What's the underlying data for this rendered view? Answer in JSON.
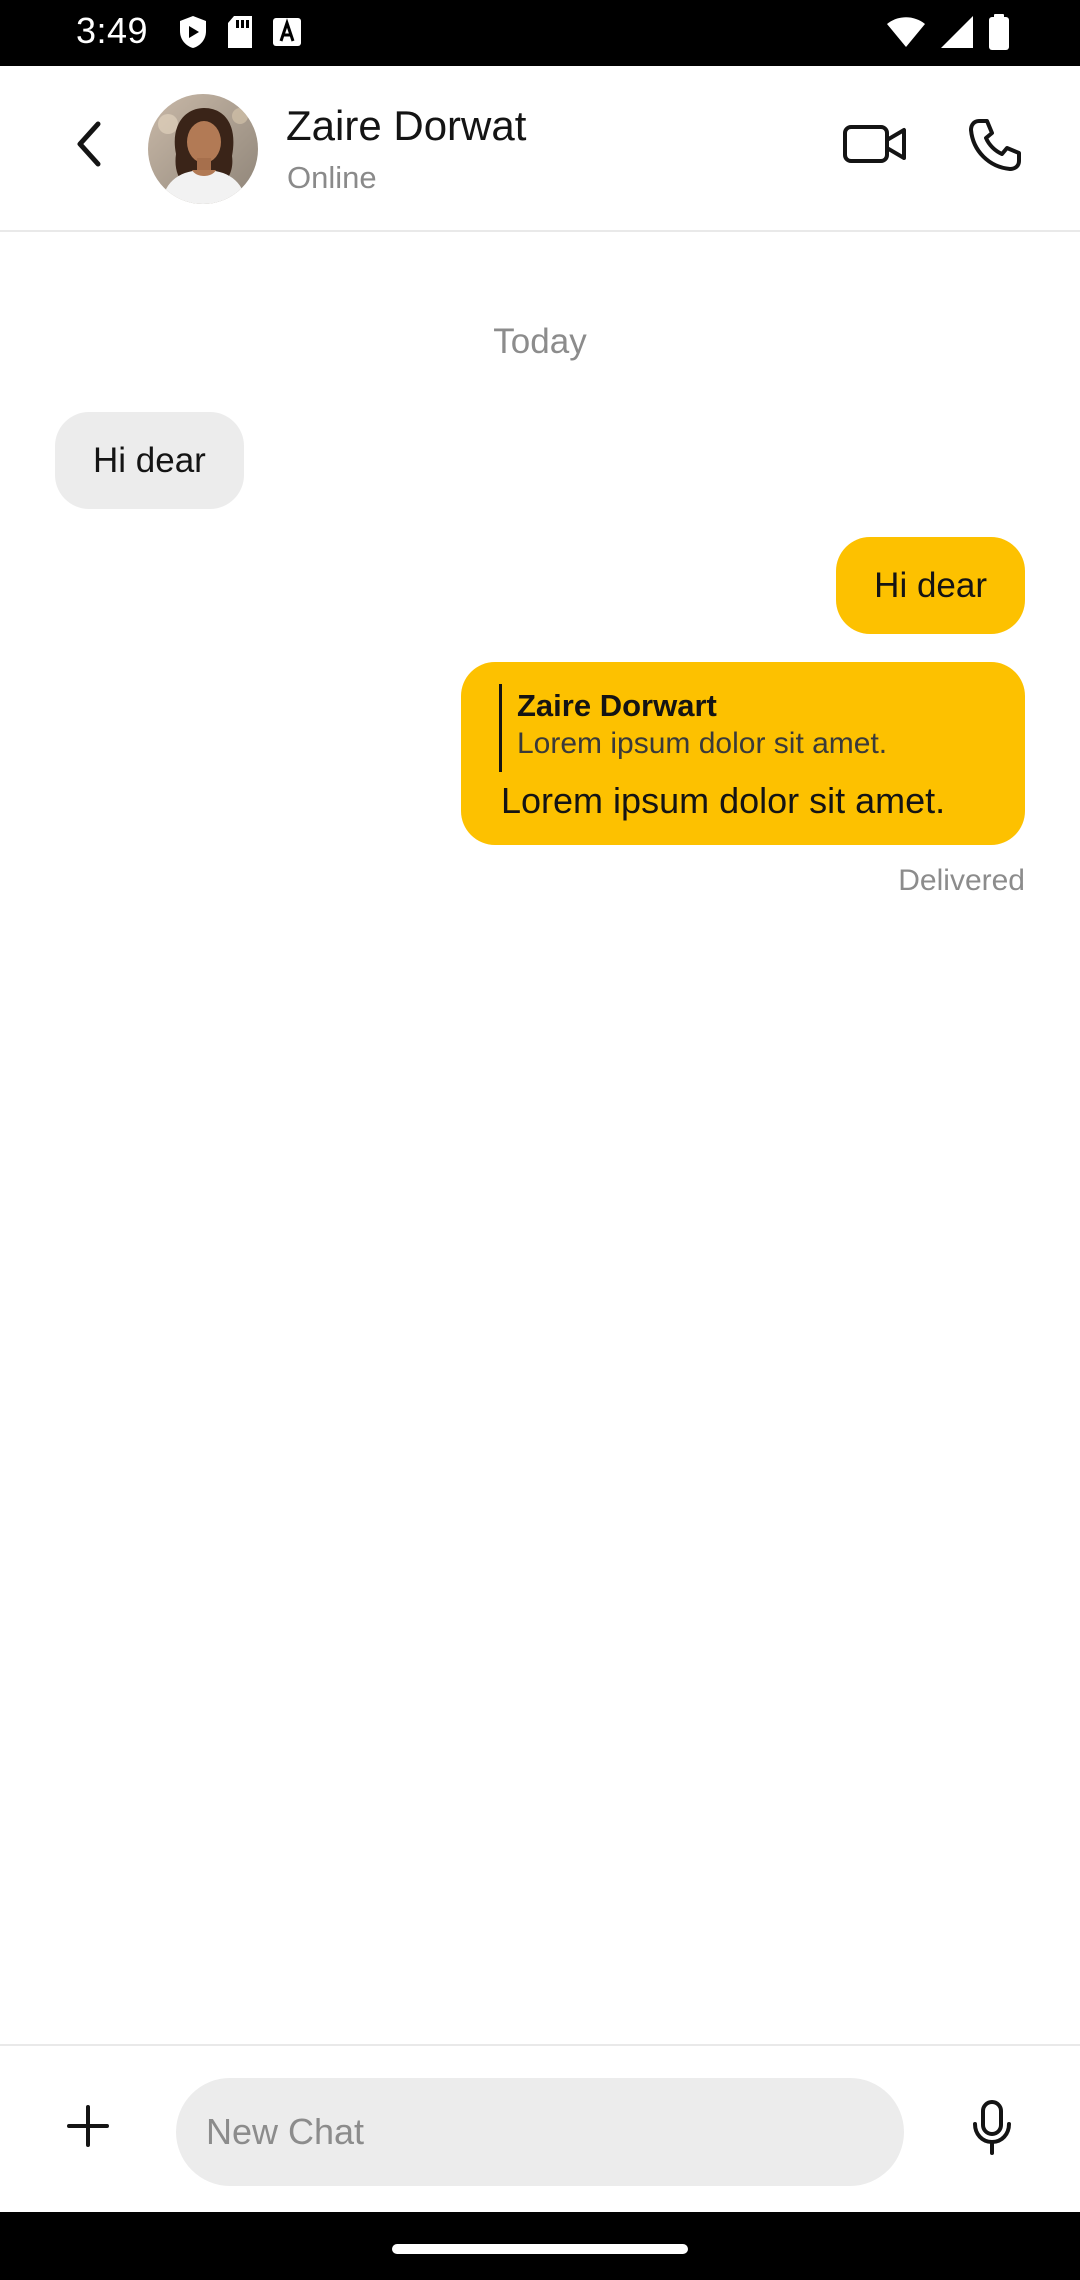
{
  "status_bar": {
    "time": "3:49",
    "left_icons": [
      "shield-icon",
      "sd-card-icon",
      "a-font-icon"
    ],
    "right_icons": [
      "wifi-icon",
      "signal-icon",
      "battery-icon"
    ]
  },
  "header": {
    "contact_name": "Zaire Dorwat",
    "contact_status": "Online",
    "icons": {
      "back": "chevron-left-icon",
      "video": "video-camera-icon",
      "call": "phone-icon"
    }
  },
  "chat": {
    "date_separator": "Today",
    "messages": [
      {
        "direction": "incoming",
        "text": "Hi dear"
      },
      {
        "direction": "outgoing",
        "text": "Hi dear"
      },
      {
        "direction": "outgoing",
        "reply_to": {
          "name": "Zaire Dorwart",
          "text": "Lorem ipsum dolor sit amet."
        },
        "text": "Lorem ipsum dolor sit amet."
      }
    ],
    "delivery_status": "Delivered"
  },
  "composer": {
    "placeholder": "New Chat",
    "value": "",
    "icons": {
      "add": "plus-icon",
      "mic": "microphone-icon"
    }
  },
  "colors": {
    "accent": "#FDC100",
    "incoming_bubble": "#ECECEC",
    "input_background": "#ECECEC",
    "muted_text": "#8C8C8C"
  }
}
